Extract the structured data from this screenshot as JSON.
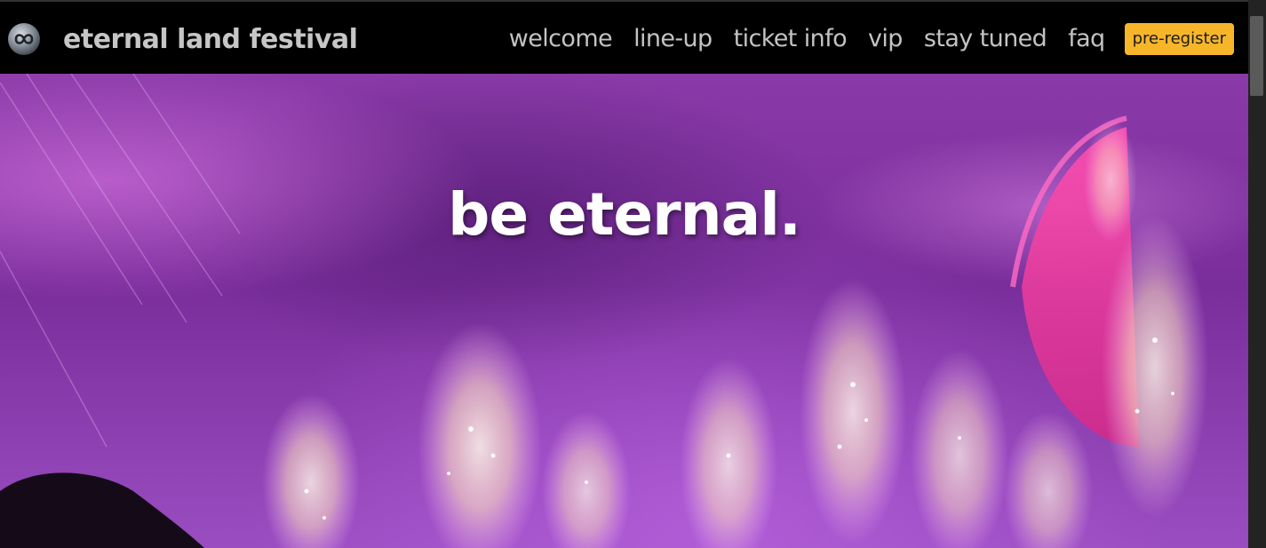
{
  "header": {
    "brand_name": "eternal land festival",
    "logo_icon": "infinity-logo-icon",
    "nav": [
      {
        "label": "welcome"
      },
      {
        "label": "line-up"
      },
      {
        "label": "ticket info"
      },
      {
        "label": "vip"
      },
      {
        "label": "stay tuned"
      },
      {
        "label": "faq"
      }
    ],
    "cta_label": "pre-register"
  },
  "hero": {
    "title": "be eternal.",
    "image": "purple concert fireworks stage"
  },
  "colors": {
    "navbar_bg": "#000000",
    "nav_text": "#c3c3c3",
    "cta_bg": "#f7b62a",
    "hero_tint": "#8a3aa8"
  }
}
